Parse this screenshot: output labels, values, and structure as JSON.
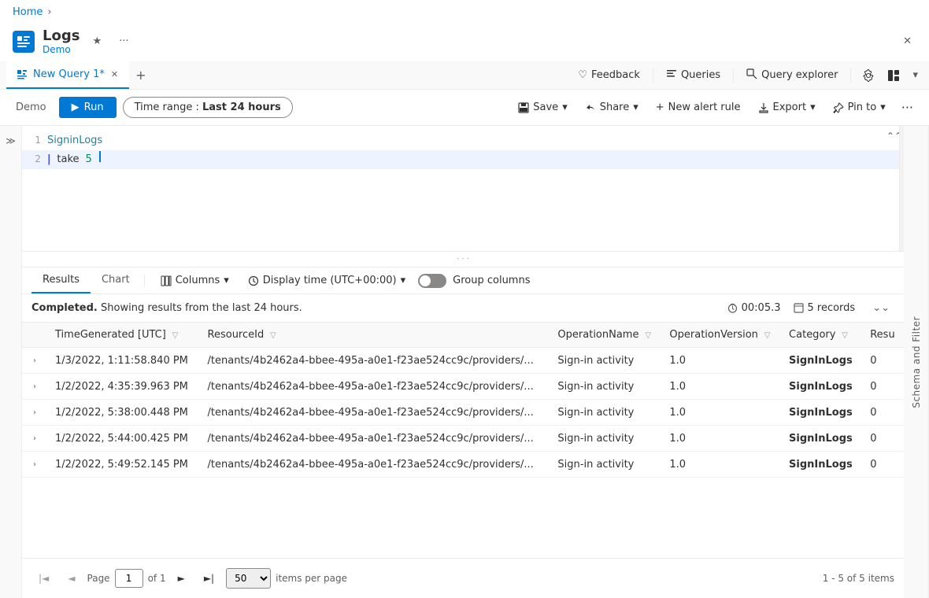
{
  "breadcrumb": {
    "home": "Home",
    "sep": "›"
  },
  "app": {
    "title": "Logs",
    "subtitle": "Demo",
    "pin_label": "★",
    "more_label": "···",
    "close_label": "✕"
  },
  "tabs": [
    {
      "label": "New Query 1*",
      "active": true,
      "closeable": true
    }
  ],
  "tab_add": "+",
  "toolbar_right_tabs": [
    {
      "label": "Feedback",
      "icon": "♡"
    },
    {
      "label": "Queries",
      "icon": "≡"
    },
    {
      "label": "Query explorer",
      "icon": "🔍"
    }
  ],
  "toolbar": {
    "workspace": "Demo",
    "run": "Run",
    "time_range_prefix": "Time range :",
    "time_range_value": "Last 24 hours",
    "save": "Save",
    "share": "Share",
    "new_alert": "New alert rule",
    "export": "Export",
    "pin_to": "Pin to",
    "more": "···"
  },
  "editor": {
    "lines": [
      {
        "num": "1",
        "content": "SigninLogs",
        "type": "table"
      },
      {
        "num": "2",
        "content": "| take 5",
        "type": "cursor"
      }
    ]
  },
  "results": {
    "tabs": [
      "Results",
      "Chart"
    ],
    "columns_btn": "Columns",
    "display_time": "Display time (UTC+00:00)",
    "group_columns": "Group columns",
    "status_completed": "Completed.",
    "status_text": "Showing results from the last 24 hours.",
    "elapsed": "00:05.3",
    "records": "5 records",
    "expand_more": "⌄",
    "columns": [
      "TimeGenerated [UTC]",
      "ResourceId",
      "OperationName",
      "OperationVersion",
      "Category",
      "Resu"
    ],
    "rows": [
      {
        "time": "1/3/2022, 1:11:58.840 PM",
        "resource": "/tenants/4b2462a4-bbee-495a-a0e1-f23ae524cc9c/providers/...",
        "operation": "Sign-in activity",
        "version": "1.0",
        "category": "SignInLogs",
        "result": "0"
      },
      {
        "time": "1/2/2022, 4:35:39.963 PM",
        "resource": "/tenants/4b2462a4-bbee-495a-a0e1-f23ae524cc9c/providers/...",
        "operation": "Sign-in activity",
        "version": "1.0",
        "category": "SignInLogs",
        "result": "0"
      },
      {
        "time": "1/2/2022, 5:38:00.448 PM",
        "resource": "/tenants/4b2462a4-bbee-495a-a0e1-f23ae524cc9c/providers/...",
        "operation": "Sign-in activity",
        "version": "1.0",
        "category": "SignInLogs",
        "result": "0"
      },
      {
        "time": "1/2/2022, 5:44:00.425 PM",
        "resource": "/tenants/4b2462a4-bbee-495a-a0e1-f23ae524cc9c/providers/...",
        "operation": "Sign-in activity",
        "version": "1.0",
        "category": "SignInLogs",
        "result": "0"
      },
      {
        "time": "1/2/2022, 5:49:52.145 PM",
        "resource": "/tenants/4b2462a4-bbee-495a-a0e1-f23ae524cc9c/providers/...",
        "operation": "Sign-in activity",
        "version": "1.0",
        "category": "SignInLogs",
        "result": "0"
      }
    ]
  },
  "pagination": {
    "page_label": "Page",
    "of_label": "of 1",
    "current_page": "1",
    "per_page": "50",
    "items_per_page": "items per page",
    "items_count": "1 - 5 of 5 items"
  },
  "schema_label": "Schema and Filter"
}
